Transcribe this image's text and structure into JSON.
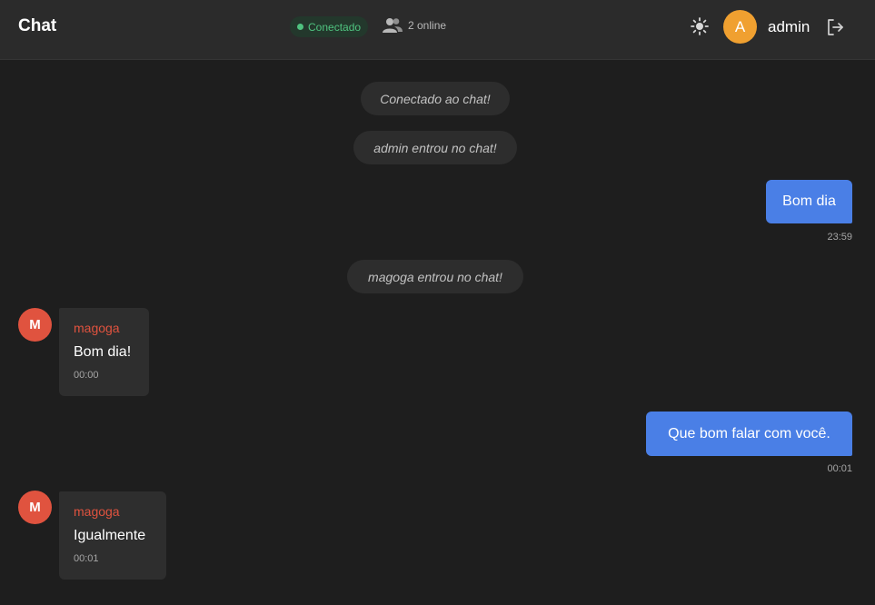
{
  "header": {
    "title": "Chat",
    "status": "Conectado",
    "online": "2 online",
    "user_initial": "A",
    "username": "admin",
    "icons": [
      "sun-icon",
      "users-icon",
      "logout-icon"
    ]
  },
  "messages": [
    {
      "type": "system",
      "text": "Conectado ao chat!"
    },
    {
      "type": "system",
      "text": "admin entrou no chat!"
    },
    {
      "type": "outgoing",
      "text": "Bom dia",
      "time": "23:59"
    },
    {
      "type": "system",
      "text": "magoga entrou no chat!"
    },
    {
      "type": "incoming",
      "initial": "M",
      "sender": "magoga",
      "text": "Bom dia!",
      "time": "00:00"
    },
    {
      "type": "outgoing",
      "text": "Que bom falar com você.",
      "time": "00:01"
    },
    {
      "type": "incoming",
      "initial": "M",
      "sender": "magoga",
      "text": "Igualmente",
      "time": "00:01"
    }
  ],
  "colors": {
    "background": "#1e1e1e",
    "header": "#2b2b2b",
    "accent_blue": "#4a7fe6",
    "status_green": "#4fc27f",
    "avatar_self": "#f0a030",
    "avatar_other": "#e0533f"
  }
}
